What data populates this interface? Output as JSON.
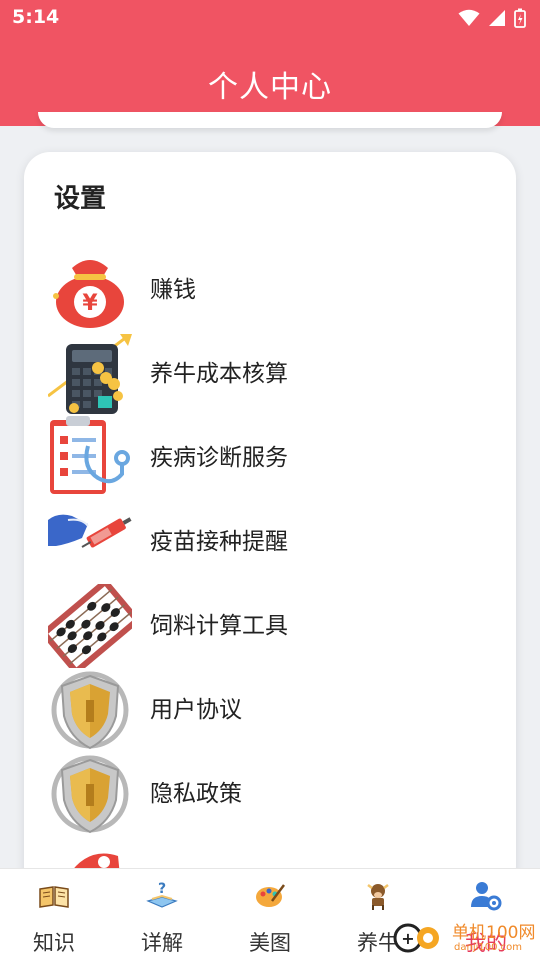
{
  "status_bar": {
    "time": "5:14"
  },
  "header": {
    "title": "个人中心"
  },
  "settings": {
    "title": "设置",
    "items": [
      {
        "label": "赚钱",
        "icon": "money-bag-icon"
      },
      {
        "label": "养牛成本核算",
        "icon": "calculator-icon"
      },
      {
        "label": "疾病诊断服务",
        "icon": "medical-report-icon"
      },
      {
        "label": "疫苗接种提醒",
        "icon": "syringe-icon"
      },
      {
        "label": "饲料计算工具",
        "icon": "abacus-icon"
      },
      {
        "label": "用户协议",
        "icon": "shield-icon"
      },
      {
        "label": "隐私政策",
        "icon": "shield-icon"
      },
      {
        "label": "",
        "icon": "partial-icon"
      }
    ]
  },
  "tab_bar": {
    "tabs": [
      {
        "label": "知识",
        "icon": "book-icon"
      },
      {
        "label": "详解",
        "icon": "question-book-icon"
      },
      {
        "label": "美图",
        "icon": "palette-icon"
      },
      {
        "label": "养牛",
        "icon": "cow-icon"
      },
      {
        "label": "我的",
        "icon": "user-settings-icon",
        "active": true
      }
    ]
  },
  "watermark": {
    "text": "单机100网",
    "subtext": "danji100.com"
  },
  "colors": {
    "brand": "#f05463",
    "active_tab": "#e63c5a"
  }
}
